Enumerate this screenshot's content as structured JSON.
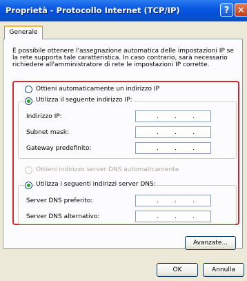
{
  "window": {
    "title": "Proprietà - Protocollo Internet (TCP/IP)",
    "help_label": "?",
    "close_label": "✕"
  },
  "tab": {
    "label": "Generale"
  },
  "description": "È possibile ottenere l'assegnazione automatica delle impostazioni IP se la rete supporta tale caratteristica. In caso contrario, sarà necessario richiedere all'amministratore di rete le impostazioni IP corrette.",
  "ip_mode": {
    "auto_label": "Ottieni automaticamente un indirizzo IP",
    "manual_label": "Utilizza il seguente indirizzo IP:",
    "selected": "manual"
  },
  "ip_fields": [
    {
      "label": "Indirizzo IP:",
      "value": " .  .  . "
    },
    {
      "label": "Subnet mask:",
      "value": " .  .  . "
    },
    {
      "label": "Gateway predefinito:",
      "value": " .  .  . "
    }
  ],
  "dns_mode": {
    "auto_label": "Ottieni indirizzo server DNS automaticamente",
    "manual_label": "Utilizza i seguenti indirizzi server DNS:",
    "selected": "manual",
    "auto_disabled": true
  },
  "dns_fields": [
    {
      "label": "Server DNS preferito:",
      "value": " .  .  . "
    },
    {
      "label": "Server DNS alternativo:",
      "value": " .  .  . "
    }
  ],
  "buttons": {
    "advanced": "Avanzate...",
    "ok": "OK",
    "cancel": "Annulla"
  },
  "colors": {
    "titlebar": "#0a58e2",
    "highlight_border": "#d9252b",
    "dialog_background": "#ece9d8"
  }
}
